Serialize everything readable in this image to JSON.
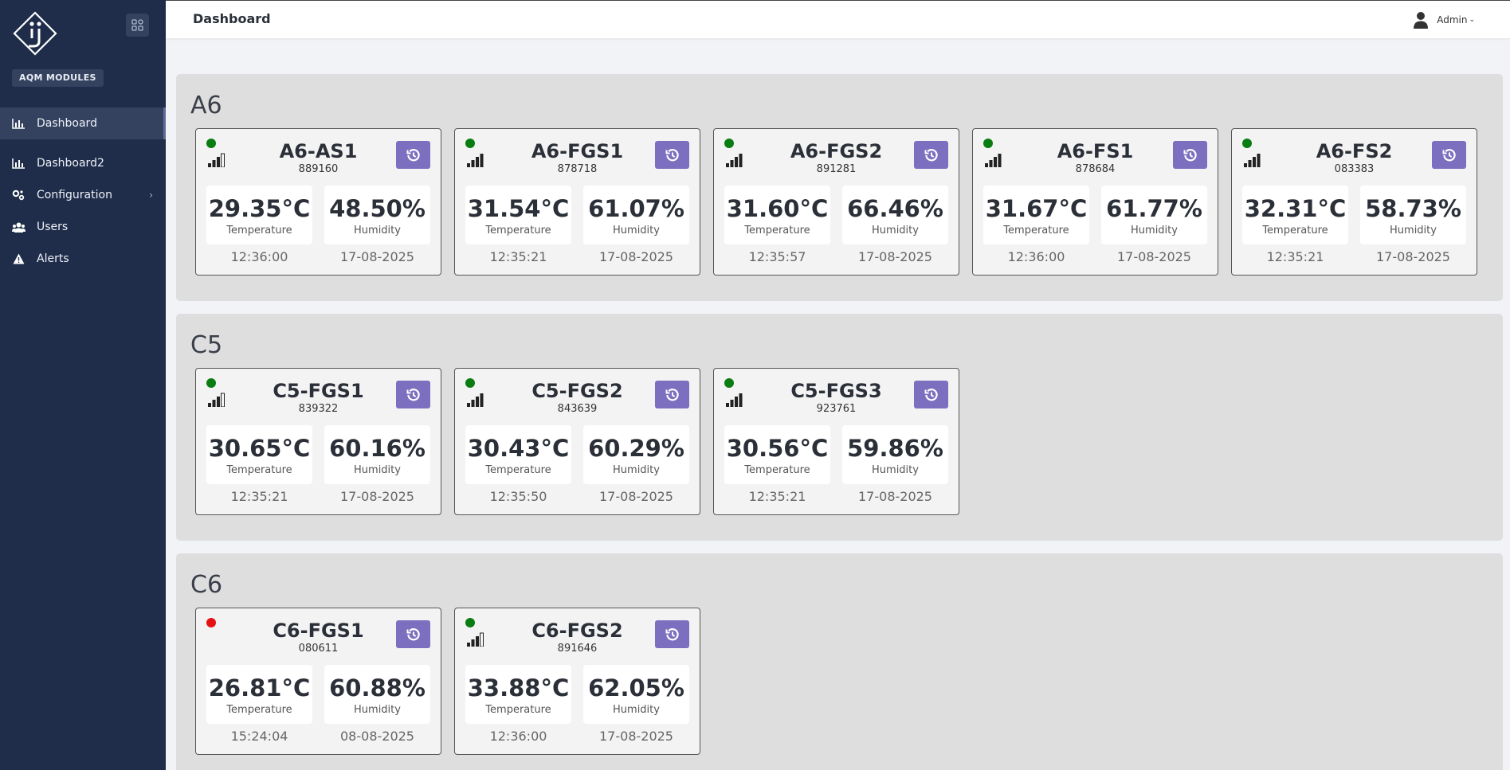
{
  "sidebar": {
    "module": "AQM MODULES",
    "items": [
      {
        "label": "Dashboard",
        "icon": "bar-chart-icon"
      },
      {
        "label": "Dashboard2",
        "icon": "bar-chart-icon"
      },
      {
        "label": "Configuration",
        "icon": "cogs-icon"
      },
      {
        "label": "Users",
        "icon": "users-icon"
      },
      {
        "label": "Alerts",
        "icon": "warning-icon"
      }
    ]
  },
  "header": {
    "title": "Dashboard",
    "user": "Admin"
  },
  "labels": {
    "temperature": "Temperature",
    "humidity": "Humidity"
  },
  "colors": {
    "online": "#0a7d12",
    "offline": "#e41313",
    "accent": "#7d6fc0",
    "sidebar": "#1f2d4a"
  },
  "groups": [
    {
      "name": "A6",
      "devices": [
        {
          "name": "A6-AS1",
          "id": "889160",
          "status": "online",
          "signal": 3,
          "temp": "29.35°C",
          "humidity": "48.50%",
          "time": "12:36:00",
          "date": "17-08-2025"
        },
        {
          "name": "A6-FGS1",
          "id": "878718",
          "status": "online",
          "signal": 4,
          "temp": "31.54°C",
          "humidity": "61.07%",
          "time": "12:35:21",
          "date": "17-08-2025"
        },
        {
          "name": "A6-FGS2",
          "id": "891281",
          "status": "online",
          "signal": 4,
          "temp": "31.60°C",
          "humidity": "66.46%",
          "time": "12:35:57",
          "date": "17-08-2025"
        },
        {
          "name": "A6-FS1",
          "id": "878684",
          "status": "online",
          "signal": 4,
          "temp": "31.67°C",
          "humidity": "61.77%",
          "time": "12:36:00",
          "date": "17-08-2025"
        },
        {
          "name": "A6-FS2",
          "id": "083383",
          "status": "online",
          "signal": 4,
          "temp": "32.31°C",
          "humidity": "58.73%",
          "time": "12:35:21",
          "date": "17-08-2025"
        }
      ]
    },
    {
      "name": "C5",
      "devices": [
        {
          "name": "C5-FGS1",
          "id": "839322",
          "status": "online",
          "signal": 3,
          "temp": "30.65°C",
          "humidity": "60.16%",
          "time": "12:35:21",
          "date": "17-08-2025"
        },
        {
          "name": "C5-FGS2",
          "id": "843639",
          "status": "online",
          "signal": 4,
          "temp": "30.43°C",
          "humidity": "60.29%",
          "time": "12:35:50",
          "date": "17-08-2025"
        },
        {
          "name": "C5-FGS3",
          "id": "923761",
          "status": "online",
          "signal": 4,
          "temp": "30.56°C",
          "humidity": "59.86%",
          "time": "12:35:21",
          "date": "17-08-2025"
        }
      ]
    },
    {
      "name": "C6",
      "devices": [
        {
          "name": "C6-FGS1",
          "id": "080611",
          "status": "offline",
          "signal": 0,
          "temp": "26.81°C",
          "humidity": "60.88%",
          "time": "15:24:04",
          "date": "08-08-2025"
        },
        {
          "name": "C6-FGS2",
          "id": "891646",
          "status": "online",
          "signal": 3,
          "temp": "33.88°C",
          "humidity": "62.05%",
          "time": "12:36:00",
          "date": "17-08-2025"
        }
      ]
    }
  ]
}
